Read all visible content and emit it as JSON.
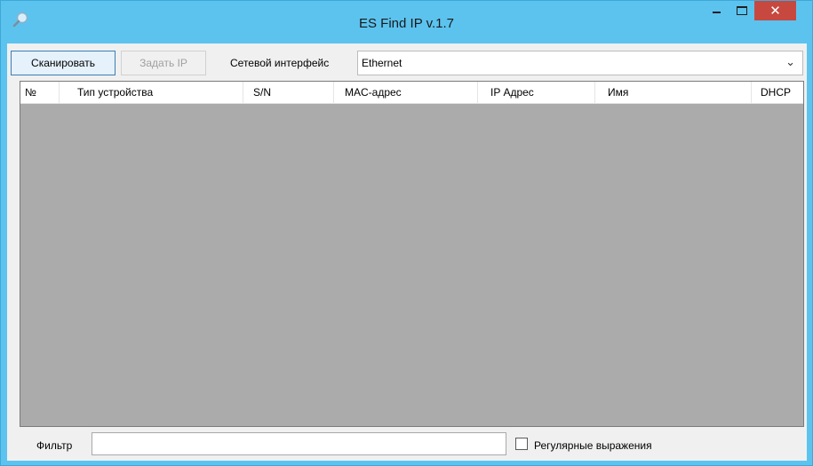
{
  "window": {
    "title": "ES Find IP v.1.7",
    "close_glyph": "✕",
    "app_icon": "magnifier-icon"
  },
  "toolbar": {
    "scan_label": "Сканировать",
    "set_ip_label": "Задать IP",
    "interface_label": "Сетевой интерфейс",
    "interface_value": "Ethernet",
    "dropdown_glyph": "⌄"
  },
  "table": {
    "columns": [
      "№",
      "Тип устройства",
      "S/N",
      "MAC-адрес",
      "IP Адрес",
      "Имя",
      "DHCP"
    ]
  },
  "filter": {
    "label": "Фильтр",
    "value": "",
    "regex_label": "Регулярные выражения",
    "regex_checked": false
  },
  "colors": {
    "titlebar": "#5cc3ef",
    "close_button": "#c7483f",
    "grid_background": "#ababab"
  }
}
